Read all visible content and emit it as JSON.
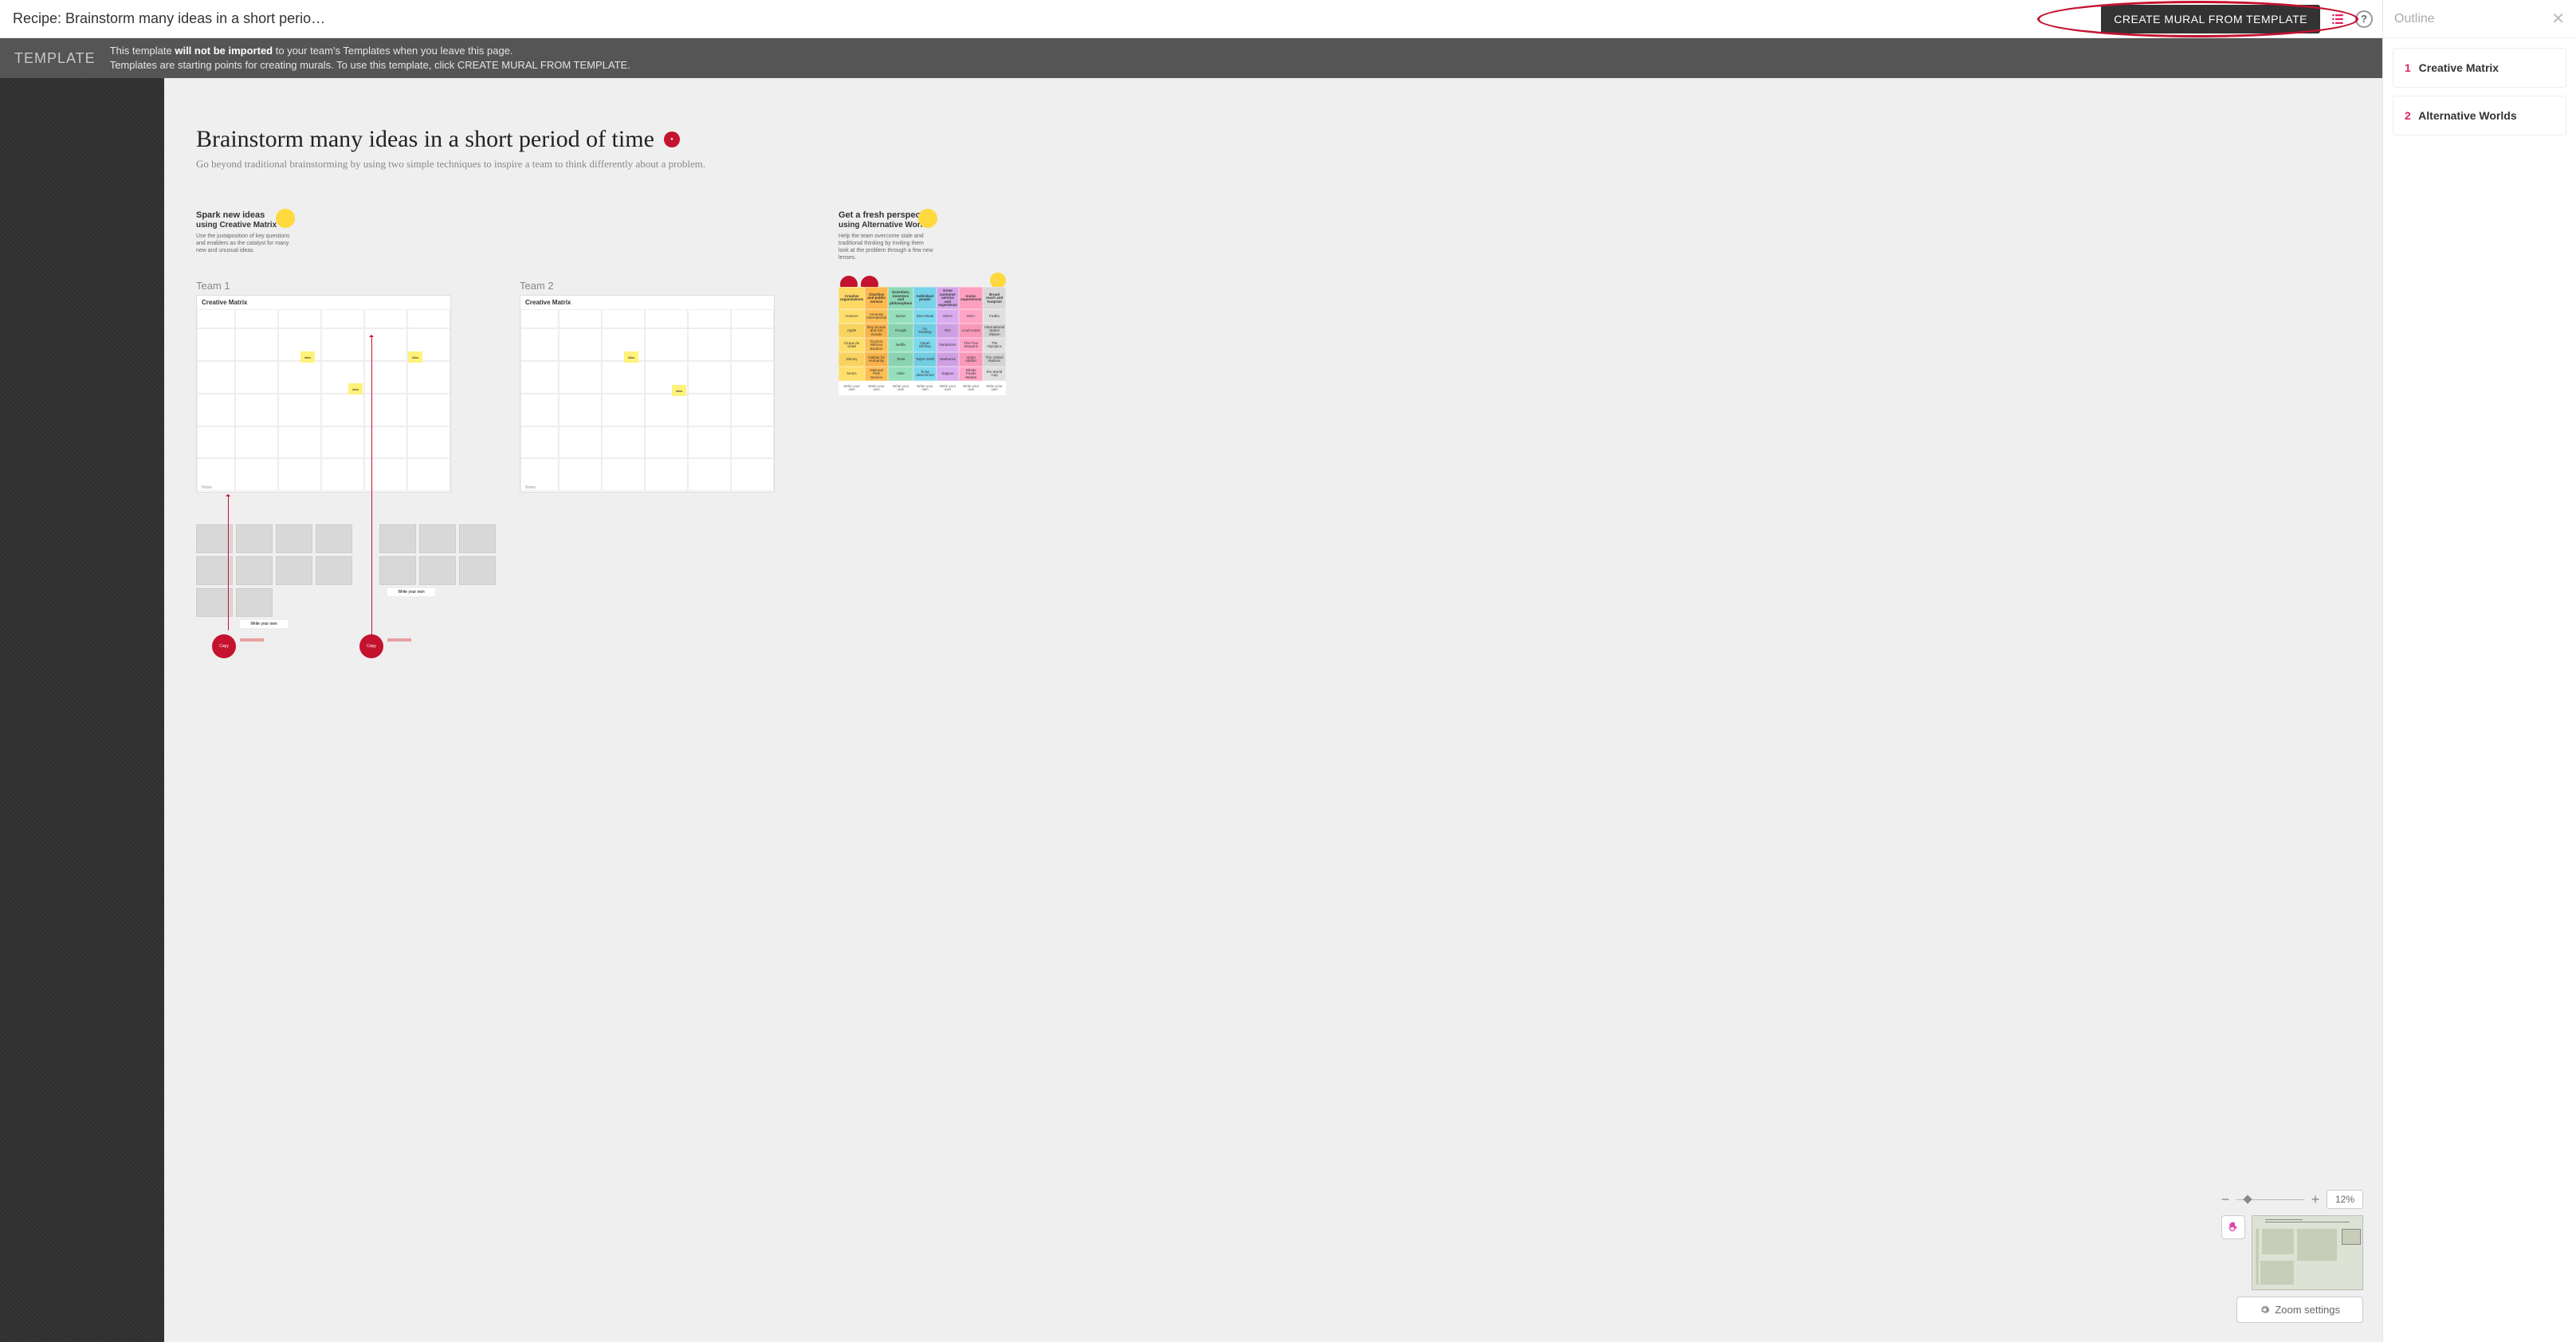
{
  "header": {
    "recipe_title": "Recipe: Brainstorm many ideas in a short perio…",
    "create_button": "CREATE MURAL FROM TEMPLATE",
    "help_char": "?"
  },
  "banner": {
    "label": "TEMPLATE",
    "line1a": "This template ",
    "line1b": "will not be imported",
    "line1c": " to your team's Templates when you leave this page.",
    "line2": "Templates are starting points for creating murals. To use this template, click CREATE MURAL FROM TEMPLATE."
  },
  "mural": {
    "title": "Brainstorm many ideas in a short period of time",
    "subtitle": "Go beyond traditional brainstorming by using two simple techniques to inspire a team to think differently about a problem."
  },
  "section1": {
    "h1": "Spark new ideas",
    "h2": "using Creative Matrix",
    "desc": "Use the juxtaposition of key questions and enablers as the catalyst for many new and unusual ideas.",
    "team1": "Team 1",
    "team2": "Team 2",
    "matrix_label": "Creative Matrix",
    "sticky": "idea",
    "write_your_own": "Write your own"
  },
  "section2": {
    "h1": "Get a fresh perspective",
    "h2": "using Alternative Worlds",
    "desc": "Help the team overcome stale and traditional thinking by inviting them look at the problem through a few new lenses.",
    "table": [
      [
        "Creative organizations",
        "Charities and public service",
        "Scientists, inventors and philosophers",
        "Individual people",
        "Great customer service and experience",
        "Iconic experiences",
        "Broad reach and footprint"
      ],
      [
        "Amazon",
        "Amnesty International",
        "Dyson",
        "Elon Musk",
        "USAA",
        "IKEA",
        "FedEx"
      ],
      [
        "Apple",
        "Boy Scouts and Girl Scouts",
        "Google",
        "J.K. Rowling",
        "Ritz",
        "Loud cruise",
        "International Space Station"
      ],
      [
        "Cirque du Soleil",
        "Doctors Without Borders",
        "Netflix",
        "Oprah Winfrey",
        "Nordstrom",
        "The Four Seasons",
        "The Olympics"
      ],
      [
        "Disney",
        "Habitat for Humanity",
        "Tesla",
        "Taylor Swift",
        "Starbucks",
        "Virgin Atlantic",
        "The United Nations"
      ],
      [
        "NASA",
        "National Park Service",
        "Uber",
        "To be determined",
        "Zappos",
        "Whole Foods Market",
        "the World Cup"
      ],
      [
        "Write your own",
        "Write your own",
        "Write your own",
        "Write your own",
        "Write your own",
        "Write your own",
        "Write your own"
      ]
    ],
    "colorsByCol": [
      "#ffd966",
      "#ffb84d",
      "#8fd9b6",
      "#77d3e8",
      "#d4a5e8",
      "#ff9fc0",
      "#d9d9d9"
    ]
  },
  "zoom": {
    "percent": "12%",
    "settings": "Zoom settings"
  },
  "outline": {
    "title": "Outline",
    "items": [
      {
        "num": "1",
        "label": "Creative Matrix"
      },
      {
        "num": "2",
        "label": "Alternative Worlds"
      }
    ]
  }
}
